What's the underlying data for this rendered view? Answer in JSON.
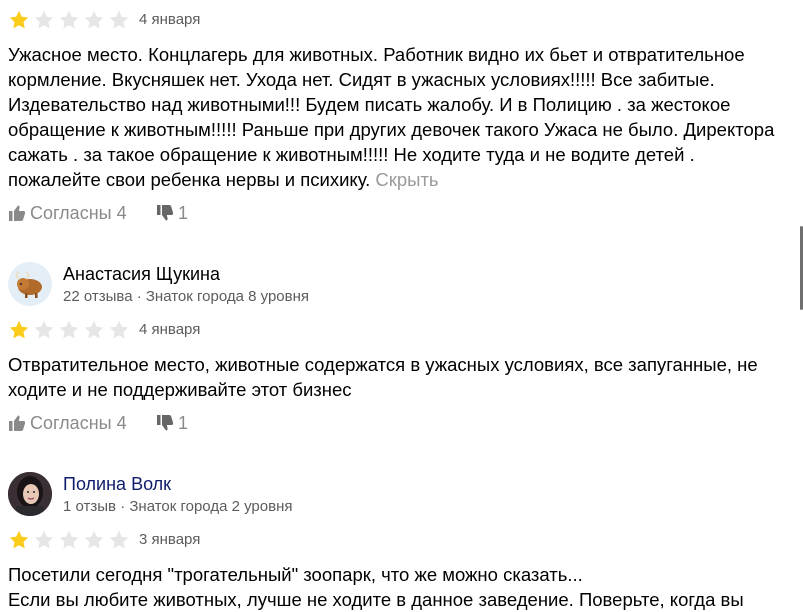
{
  "colors": {
    "star_filled": "#fccc1b",
    "star_empty": "#e6e6e6",
    "author_link": "#0d1c6b",
    "muted": "#5c5c5c",
    "action_grey": "#8a8a8a"
  },
  "reviews": [
    {
      "rating": 1,
      "date": "4 января",
      "text": "Ужасное место. Концлагерь для животных. Работник видно их бьет и отвратительное кормление. Вкусняшек нет. Ухода нет. Сидят в ужасных условиях!!!!! Все забитые. Издевательство над животными!!! Будем писать жалобу. И в Полицию . за жестокое обращение к животным!!!!! Раньше при других девочек такого Ужаса не было. Директора сажать . за такое обращение к животным!!!!! Не ходите туда и не водите детей . пожалейте свои ребенка нервы и психику.",
      "hide_label": "Скрыть",
      "likes_label": "Согласны 4",
      "dislikes": "1"
    },
    {
      "author": "Анастасия Щукина",
      "meta": "22 отзыва · Знаток города 8 уровня",
      "avatar_icon": "yak-avatar-icon",
      "rating": 1,
      "date": "4 января",
      "text": "Отвратительное место, животные содержатся в ужасных условиях, все запуганные, не ходите и не поддерживайте этот бизнес",
      "likes_label": "Согласны 4",
      "dislikes": "1"
    },
    {
      "author": "Полина Волк",
      "meta": "1 отзыв · Знаток города 2 уровня",
      "avatar_icon": "user-photo-avatar",
      "rating": 1,
      "date": "3 января",
      "text": "Посетили сегодня \"трогательный\" зоопарк, что же можно сказать...",
      "text_cut": "Если вы любите животных, лучше не ходите в данное заведение. Поверьте, когда вы"
    }
  ]
}
